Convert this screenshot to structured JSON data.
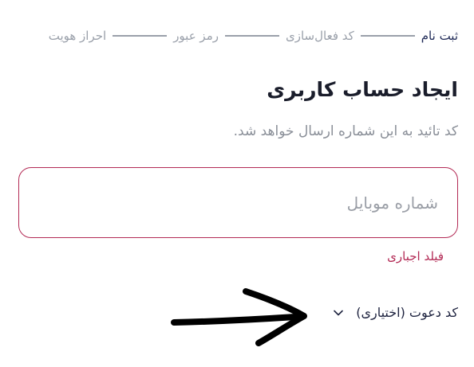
{
  "stepper": {
    "steps": [
      {
        "label": "ثبت نام",
        "active": true
      },
      {
        "label": "کد فعال‌سازی",
        "active": false
      },
      {
        "label": "رمز عبور",
        "active": false
      },
      {
        "label": "احراز هویت",
        "active": false
      }
    ]
  },
  "page": {
    "title": "ایجاد حساب کاربری",
    "subtitle": "کد تائید به این شماره ارسال خواهد شد."
  },
  "phone_field": {
    "placeholder": "شماره موبایل",
    "value": "",
    "error": "فیلد اجباری"
  },
  "invite": {
    "label": "کد دعوت (اختیاری)",
    "icon": "chevron-down-icon"
  },
  "annotation": {
    "icon": "hand-drawn-arrow-icon"
  },
  "colors": {
    "accent": "#b32a55",
    "text_primary": "#1a1d2b",
    "text_muted": "#9aa0aa",
    "step_active": "#1f2a57"
  }
}
